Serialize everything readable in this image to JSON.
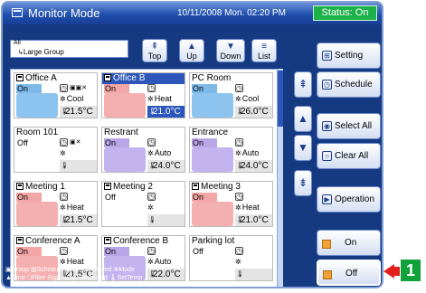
{
  "title": "Monitor Mode",
  "datetime": "10/11/2008 Mon. 02:20 PM",
  "status": "Status: On",
  "group": {
    "line1": "All",
    "line2": "Large Group"
  },
  "nav": [
    {
      "label": "Top",
      "icon": "⇞"
    },
    {
      "label": "Up",
      "icon": "▲"
    },
    {
      "label": "Down",
      "icon": "▼"
    },
    {
      "label": "List",
      "icon": "≡"
    }
  ],
  "tiles": [
    {
      "name": "Office A",
      "state": "On",
      "mode": "Cool",
      "temp": "21.5°C",
      "has_icon": true,
      "marks": "▣▣✕",
      "style": "on-cool",
      "selected": false
    },
    {
      "name": "Office B",
      "state": "On",
      "mode": "Heat",
      "temp": "21.0°C",
      "has_icon": true,
      "marks": "",
      "style": "on-heat",
      "selected": true
    },
    {
      "name": "PC Room",
      "state": "On",
      "mode": "Cool",
      "temp": "26.0°C",
      "has_icon": false,
      "marks": "",
      "style": "on-cool",
      "selected": false
    },
    {
      "name": "Room 101",
      "state": "Off",
      "mode": "",
      "temp": "",
      "has_icon": false,
      "marks": "▣✕",
      "style": "off",
      "selected": false
    },
    {
      "name": "Restrant",
      "state": "On",
      "mode": "Auto",
      "temp": "24.0°C",
      "has_icon": false,
      "marks": "",
      "style": "on-auto",
      "selected": false
    },
    {
      "name": "Entrance",
      "state": "On",
      "mode": "Auto",
      "temp": "24.0°C",
      "has_icon": false,
      "marks": "",
      "style": "on-auto",
      "selected": false
    },
    {
      "name": "Meeting 1",
      "state": "On",
      "mode": "Heat",
      "temp": "21.5°C",
      "has_icon": true,
      "marks": "",
      "style": "on-heat",
      "selected": false
    },
    {
      "name": "Meeting 2",
      "state": "Off",
      "mode": "",
      "temp": "",
      "has_icon": true,
      "marks": "",
      "style": "off",
      "selected": false
    },
    {
      "name": "Meeting 3",
      "state": "On",
      "mode": "Heat",
      "temp": "21.0°C",
      "has_icon": true,
      "marks": "",
      "style": "on-heat",
      "selected": false
    },
    {
      "name": "Conference A",
      "state": "On",
      "mode": "Heat",
      "temp": "21.5°C",
      "has_icon": true,
      "marks": "",
      "style": "on-heat",
      "selected": false
    },
    {
      "name": "Conference B",
      "state": "On",
      "mode": "Auto",
      "temp": "22.0°C",
      "has_icon": true,
      "marks": "",
      "style": "on-auto",
      "selected": false
    },
    {
      "name": "Parking lot",
      "state": "Off",
      "mode": "",
      "temp": "",
      "has_icon": false,
      "marks": "",
      "style": "off",
      "selected": false
    }
  ],
  "scroll_arrows": [
    "⇞",
    "▲",
    "▼",
    "⇟"
  ],
  "legend": [
    "▣Group ▨Schedule ▣Op. Controlled ✲Mode",
    "▲Error □Filter Sign ⊘Op. Restricted 🌡SetTemp"
  ],
  "right_buttons": {
    "setting": "Setting",
    "schedule": "Schedule",
    "select_all": "Select All",
    "clear_all": "Clear All",
    "operation": "Operation",
    "on": "On",
    "off": "Off"
  },
  "callout": "1",
  "colors": {
    "title_bar": "#1f4fae",
    "status_on": "#1db14a",
    "callout_badge": "#11a13a",
    "callout_arrow": "#e41d1d"
  }
}
